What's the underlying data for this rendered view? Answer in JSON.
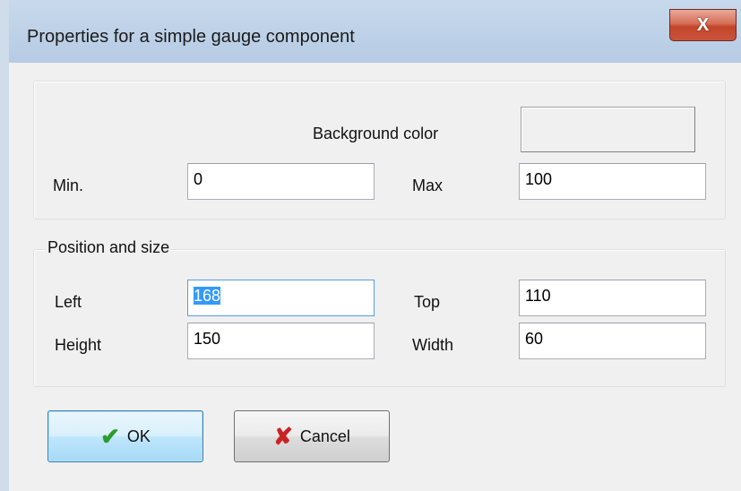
{
  "window": {
    "title": "Properties for a simple gauge component",
    "close_symbol": "X"
  },
  "range": {
    "background_color_label": "Background color",
    "min_label": "Min.",
    "min_value": "0",
    "max_label": "Max",
    "max_value": "100"
  },
  "position": {
    "group_label": "Position and size",
    "left_label": "Left",
    "left_value": "168",
    "top_label": "Top",
    "top_value": "110",
    "height_label": "Height",
    "height_value": "150",
    "width_label": "Width",
    "width_value": "60"
  },
  "buttons": {
    "ok_label": "OK",
    "cancel_label": "Cancel"
  },
  "icons": {
    "ok": "check-icon",
    "cancel": "cross-icon",
    "close": "close-icon"
  },
  "colors": {
    "selection": "#3399ff",
    "ok_check": "#2e9b2e",
    "cancel_cross": "#c92323",
    "close_button": "#c9543a"
  }
}
